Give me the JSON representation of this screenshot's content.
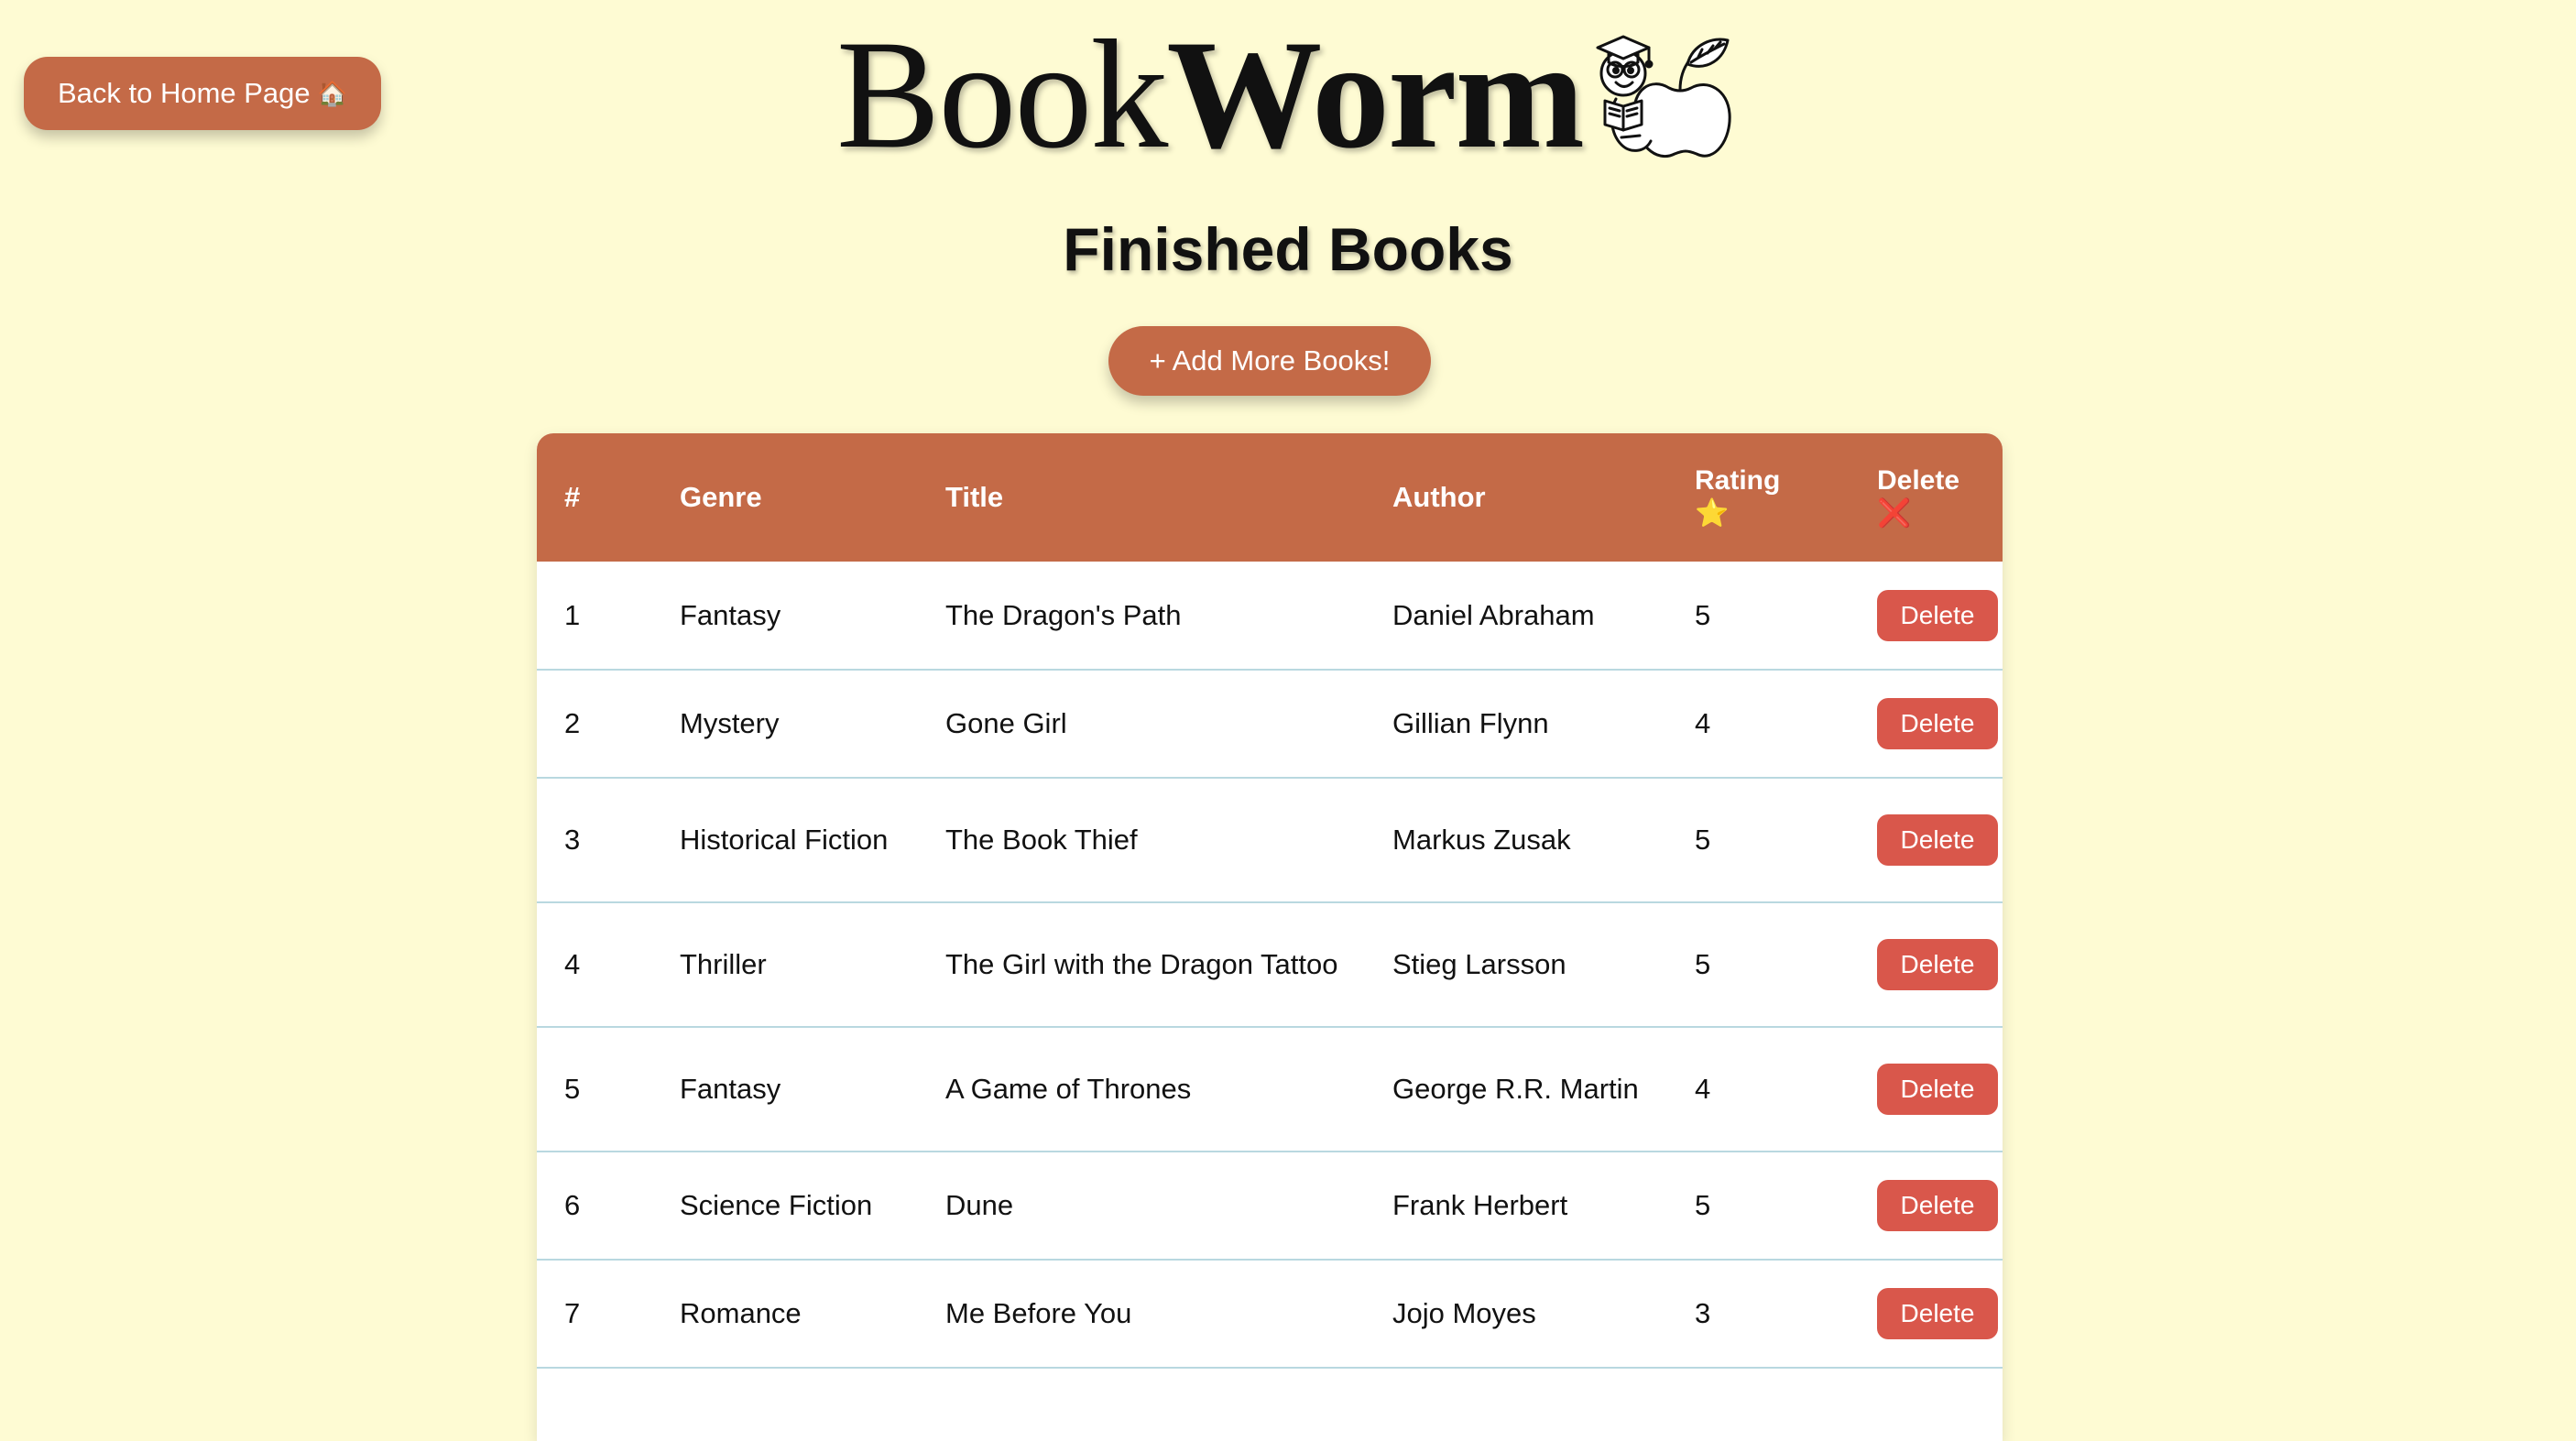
{
  "header": {
    "home_button_label": "Back to Home Page",
    "home_button_icon": "house-icon",
    "logo_part1": "Book",
    "logo_part2": "Worm",
    "mascot_icon": "bookworm-mascot-icon"
  },
  "page_title": "Finished Books",
  "add_button_label": "+ Add More Books!",
  "table": {
    "columns": {
      "num": "#",
      "genre": "Genre",
      "title": "Title",
      "author": "Author",
      "rating": "Rating",
      "rating_icon": "⭐",
      "delete": "Delete",
      "delete_icon": "❌"
    },
    "delete_label": "Delete",
    "rows": [
      {
        "num": "1",
        "genre": "Fantasy",
        "title": "The Dragon's Path",
        "author": "Daniel Abraham",
        "rating": "5"
      },
      {
        "num": "2",
        "genre": "Mystery",
        "title": "Gone Girl",
        "author": "Gillian Flynn",
        "rating": "4"
      },
      {
        "num": "3",
        "genre": "Historical Fiction",
        "title": "The Book Thief",
        "author": "Markus Zusak",
        "rating": "5"
      },
      {
        "num": "4",
        "genre": "Thriller",
        "title": "The Girl with the Dragon Tattoo",
        "author": "Stieg Larsson",
        "rating": "5"
      },
      {
        "num": "5",
        "genre": "Fantasy",
        "title": "A Game of Thrones",
        "author": "George R.R. Martin",
        "rating": "4"
      },
      {
        "num": "6",
        "genre": "Science Fiction",
        "title": "Dune",
        "author": "Frank Herbert",
        "rating": "5"
      },
      {
        "num": "7",
        "genre": "Romance",
        "title": "Me Before You",
        "author": "Jojo Moyes",
        "rating": "3"
      }
    ]
  },
  "colors": {
    "background": "#fefbd3",
    "accent": "#c46a47",
    "delete_button": "#d9574b",
    "row_divider": "#b9d8e0"
  }
}
